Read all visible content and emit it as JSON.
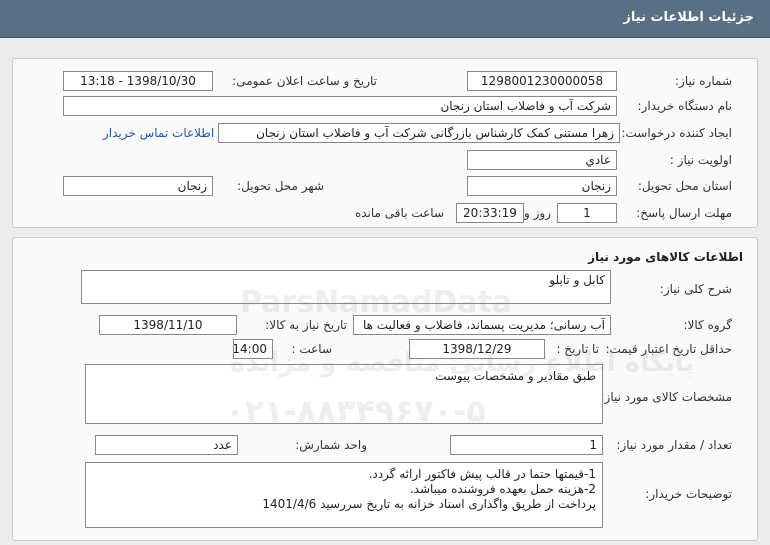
{
  "header": {
    "title": "جزئیات اطلاعات نیاز"
  },
  "info": {
    "need_number_label": "شماره نیاز:",
    "need_number": "1298001230000058",
    "announce_label": "تاریخ و ساعت اعلان عمومی:",
    "announce_value": "1398/10/30 - 13:18",
    "buyer_label": "نام دستگاه خریدار:",
    "buyer_value": "شرکت آب و فاضلاب استان زنجان",
    "creator_label": "ایجاد کننده درخواست:",
    "creator_value": "زهرا مستنی کمک کارشناس بازرگانی شرکت آب و فاضلاب استان زنجان",
    "contact_link": "اطلاعات تماس خریدار",
    "priority_label": "اولویت نیاز :",
    "priority_value": "عادي",
    "province_label": "استان محل تحویل:",
    "province_value": "زنجان",
    "city_label": "شهر محل تحویل:",
    "city_value": "زنجان",
    "deadline_label": "مهلت ارسال پاسخ:",
    "deadline_days": "1",
    "days_and_label": "روز و",
    "deadline_time": "20:33:19",
    "remaining_label": "ساعت باقی مانده"
  },
  "goods": {
    "section_title": "اطلاعات کالاهای مورد نیاز",
    "desc_label": "شرح کلی نیاز:",
    "desc_value": "کابل و تابلو",
    "group_label": "گروه کالا:",
    "group_value": "آب رسانی؛ مدیریت پسماند، فاضلاب و فعالیت ها",
    "need_date_label": "تاریخ نیاز به کالا:",
    "need_date_value": "1398/11/10",
    "validity_label": "حداقل تاریخ اعتبار قیمت:",
    "until_date_label": "تا تاریخ :",
    "until_date_value": "1398/12/29",
    "time_label": "ساعت :",
    "time_value": "14:00",
    "specs_label": "مشخصات کالای مورد نیاز:",
    "specs_value": "طبق مقادیر و مشخصات پیوست",
    "count_label": "تعداد / مقدار مورد نیاز:",
    "count_value": "1",
    "unit_label": "واحد شمارش:",
    "unit_value": "عدد",
    "notes_label": "توضیحات خریدار:",
    "notes_lines": [
      "1-قیمتها حتما در قالب پیش فاکتور ارائه گردد.",
      "2-هزینه حمل بعهده فروشنده میباشد.",
      "پرداخت از طریق واگذاری اسناد خزانه به تاریخ سررسید 1401/4/6"
    ]
  },
  "watermark": {
    "brand": "ParsNamadData",
    "line1": "پایگاه اطلاع رسانی مناقصه و مزایده",
    "phone": "۰۲۱-۸۸۳۴۹۶۷۰-۵"
  }
}
